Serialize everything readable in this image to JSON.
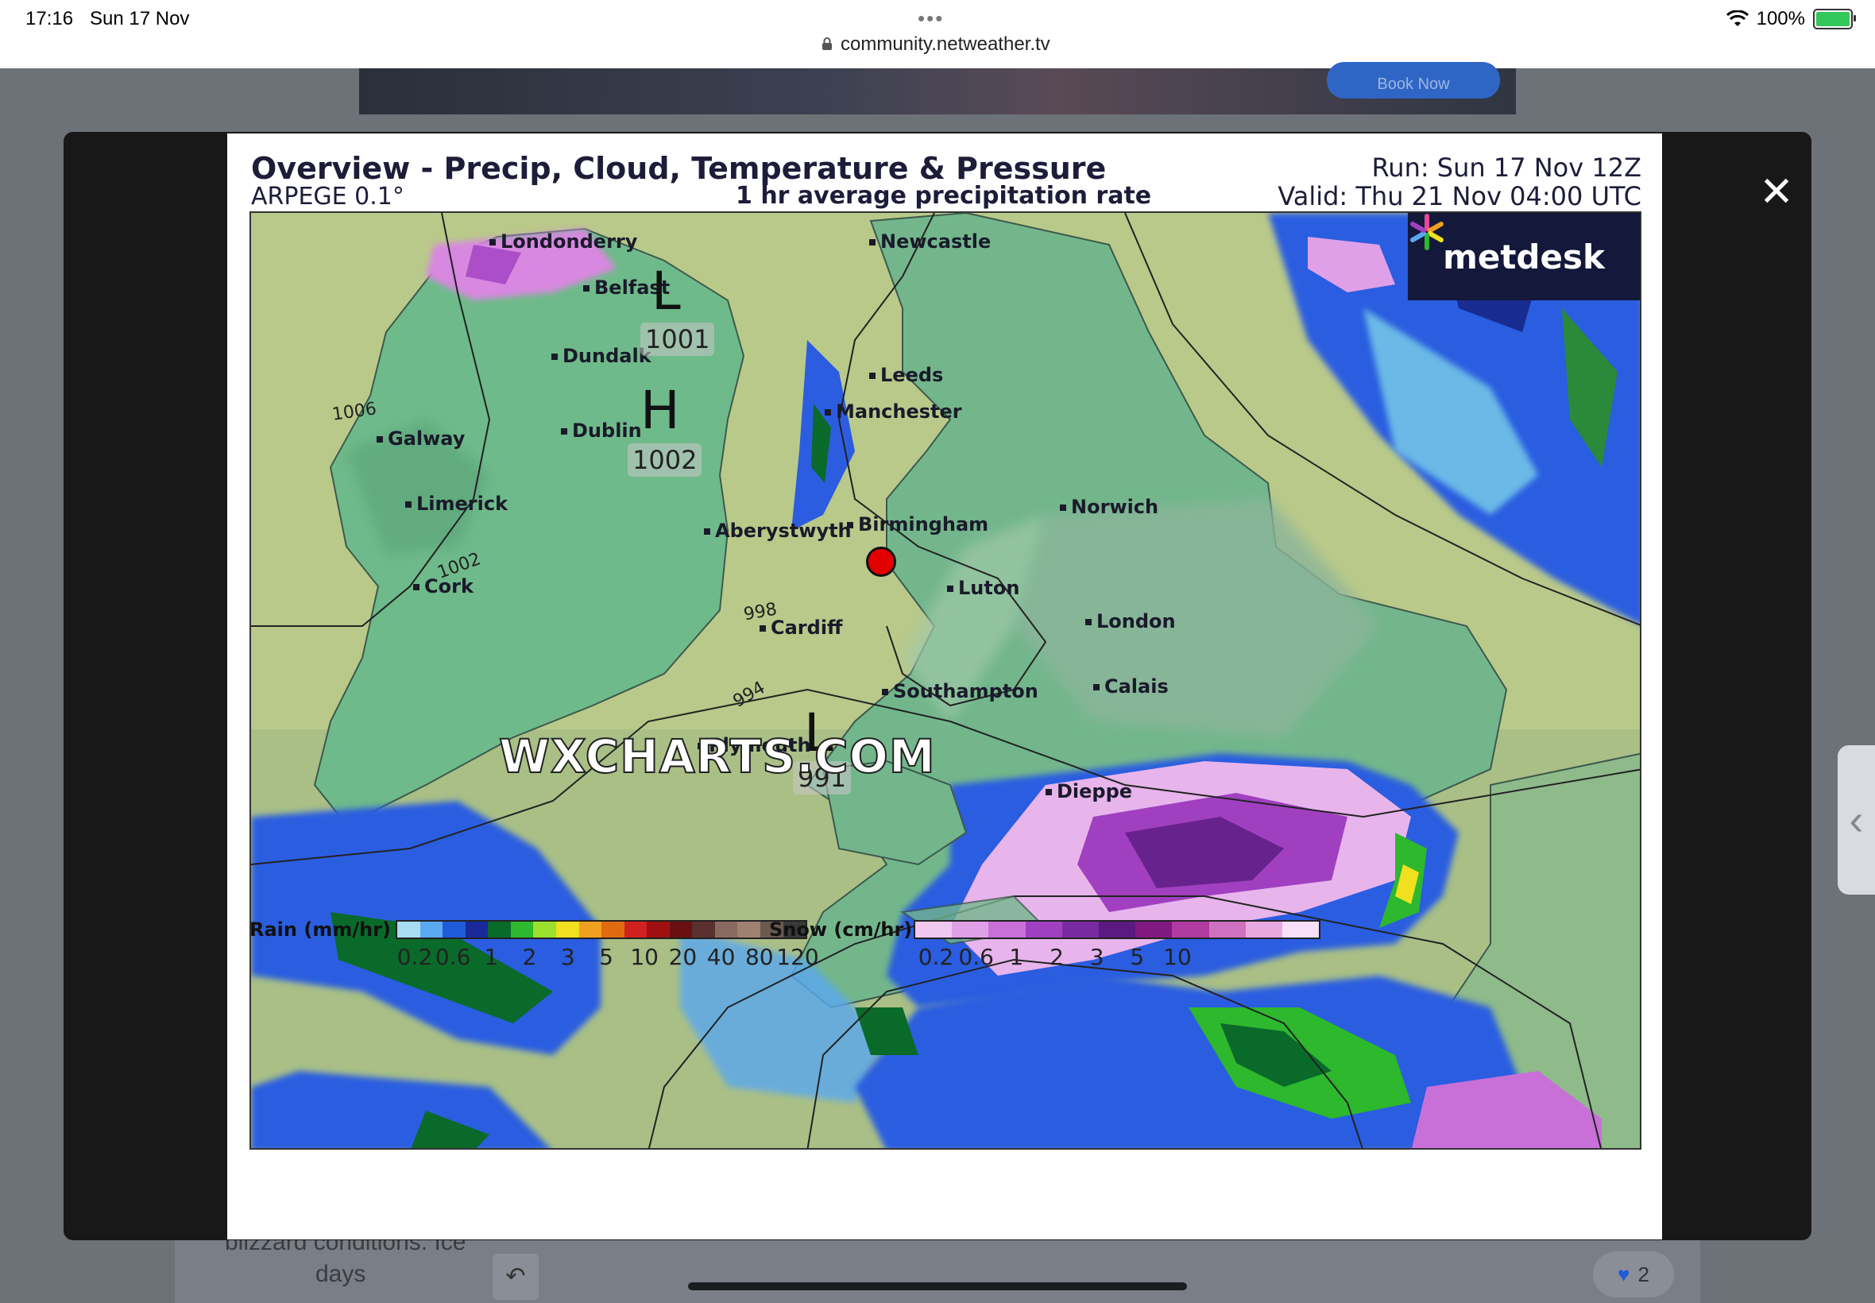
{
  "status_bar": {
    "time": "17:16",
    "date": "Sun 17 Nov",
    "url": "community.netweather.tv",
    "battery": "100%"
  },
  "background": {
    "ad_button": "Book Now",
    "post_text_1": "blizzard conditions. Ice",
    "post_text_2": "days",
    "like_count": "2"
  },
  "chart": {
    "title": "Overview - Precip, Cloud, Temperature & Pressure",
    "model": "ARPEGE 0.1°",
    "subtitle": "1 hr average precipitation rate",
    "run": "Run: Sun 17 Nov 12Z",
    "valid": "Valid: Thu 21 Nov 04:00 UTC",
    "brand": "metdesk",
    "watermark": "WXCHARTS.COM",
    "cities": {
      "londonderry": "Londonderry",
      "belfast": "Belfast",
      "newcastle": "Newcastle",
      "dundalk": "Dundalk",
      "leeds": "Leeds",
      "manchester": "Manchester",
      "dublin": "Dublin",
      "galway": "Galway",
      "limerick": "Limerick",
      "aberystwyth": "Aberystwyth",
      "birmingham": "Birmingham",
      "norwich": "Norwich",
      "cork": "Cork",
      "luton": "Luton",
      "london": "London",
      "cardiff": "Cardiff",
      "southampton": "Southampton",
      "calais": "Calais",
      "plymouth": "Plymouth",
      "dieppe": "Dieppe"
    },
    "pressure_centres": {
      "low_north": {
        "symbol": "L",
        "value": "1001"
      },
      "high": {
        "symbol": "H",
        "value": "1002"
      },
      "low_south": {
        "symbol": "L",
        "value": "991"
      }
    },
    "isobar_labels": {
      "i1006": "1006",
      "i1002": "1002",
      "i998": "998",
      "i994": "994"
    },
    "legend": {
      "rain_label": "Rain (mm/hr)",
      "rain_ticks": [
        "0.2",
        "0.6",
        "1",
        "2",
        "3",
        "5",
        "10",
        "20",
        "40",
        "80",
        "120"
      ],
      "rain_colors": [
        "#a8dcf0",
        "#5aa8f0",
        "#1f5ad8",
        "#1a2a9a",
        "#0a6a2a",
        "#2db82d",
        "#9be02d",
        "#f0e020",
        "#f0a020",
        "#e06a10",
        "#d02020",
        "#a01010",
        "#6a1010",
        "#5a3030",
        "#8a6a60",
        "#a08070",
        "#6a5a50",
        "#3a3a3a"
      ],
      "snow_label": "Snow (cm/hr)",
      "snow_ticks": [
        "0.2",
        "0.6",
        "1",
        "2",
        "3",
        "5",
        "10"
      ],
      "snow_colors": [
        "#f0c8f0",
        "#e0a0e8",
        "#c870d8",
        "#a040c0",
        "#7a2aa0",
        "#5a1a80",
        "#801a80",
        "#b03aa0",
        "#d070c0",
        "#e8a8e0",
        "#f8e0f8"
      ]
    }
  }
}
